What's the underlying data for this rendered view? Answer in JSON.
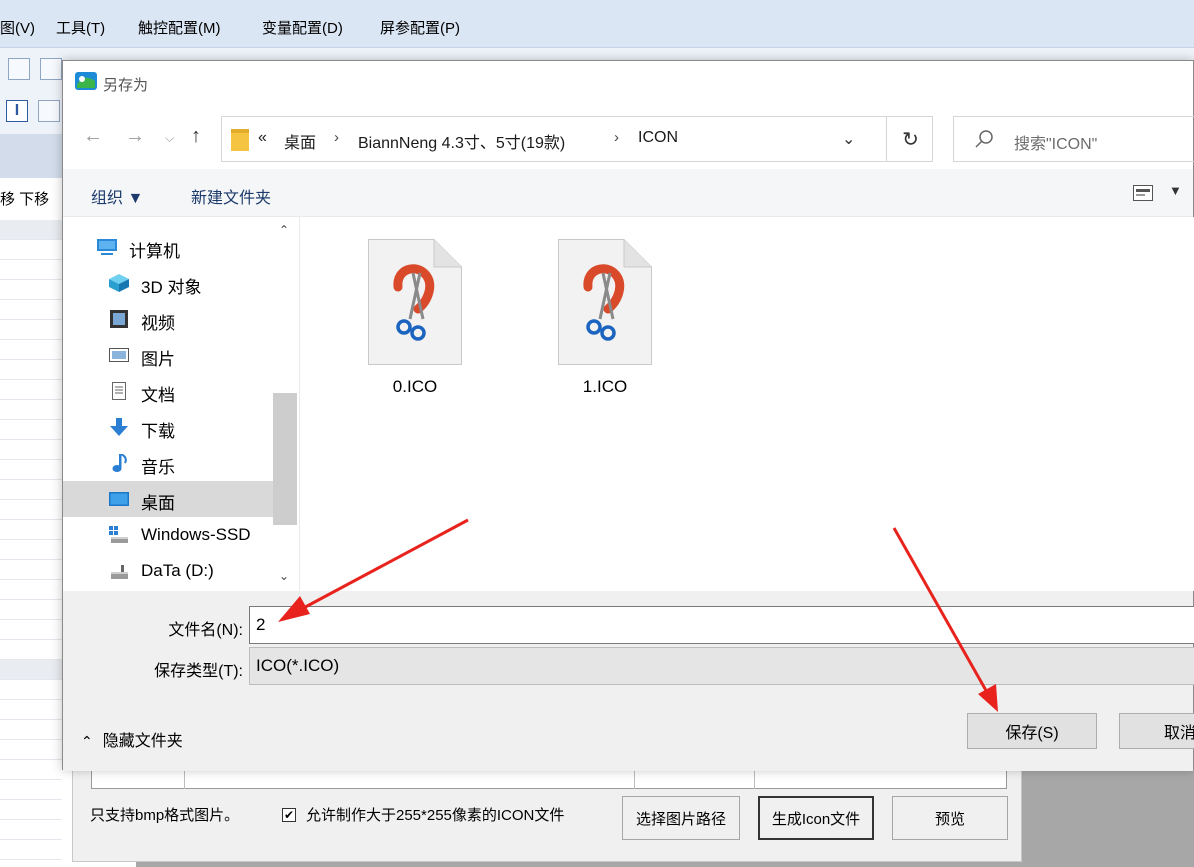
{
  "app": {
    "menu": [
      "图(V)",
      "工具(T)",
      "触控配置(M)",
      "变量配置(D)",
      "屏参配置(P)"
    ],
    "side_label": "移 下移"
  },
  "dialog": {
    "title": "另存为",
    "nav": {
      "back_icon": "arrow-left-icon",
      "forward_icon": "arrow-right-icon",
      "recent_icon": "chevron-down-icon",
      "up_icon": "arrow-up-icon"
    },
    "address": {
      "overflow": "«",
      "crumbs": [
        "桌面",
        "BiannNeng 4.3寸、5寸(19款)",
        "ICON"
      ],
      "separator": "›"
    },
    "search_placeholder": "搜索\"ICON\"",
    "commands": {
      "organize": "组织 ▼",
      "new_folder": "新建文件夹"
    },
    "nav_items": [
      {
        "label": "计算机",
        "icon": "computer-icon"
      },
      {
        "label": "3D 对象",
        "icon": "cube-icon"
      },
      {
        "label": "视频",
        "icon": "video-icon"
      },
      {
        "label": "图片",
        "icon": "picture-icon"
      },
      {
        "label": "文档",
        "icon": "document-icon"
      },
      {
        "label": "下载",
        "icon": "download-icon"
      },
      {
        "label": "音乐",
        "icon": "music-icon"
      },
      {
        "label": "桌面",
        "icon": "desktop-icon"
      },
      {
        "label": "Windows-SSD",
        "icon": "drive-icon"
      },
      {
        "label": "DaTa (D:)",
        "icon": "drive-icon"
      }
    ],
    "files": [
      {
        "name": "0.ICO",
        "icon": "ico-file-icon"
      },
      {
        "name": "1.ICO",
        "icon": "ico-file-icon"
      }
    ],
    "filename_label": "文件名(N):",
    "filename_value": "2",
    "filetype_label": "保存类型(T):",
    "filetype_value": "ICO(*.ICO)",
    "hide_folders": "隐藏文件夹",
    "save_button": "保存(S)",
    "cancel_button": "取消"
  },
  "background_dialog": {
    "note": "只支持bmp格式图片。",
    "checkbox_label": "允许制作大于255*255像素的ICON文件",
    "checkbox_checked": true,
    "select_path_button": "选择图片路径",
    "generate_button": "生成Icon文件",
    "preview_button": "预览"
  },
  "colors": {
    "arrow": "#e8231d",
    "menubar": "#dbe6f5",
    "selected_nav": "#d9d9d9"
  }
}
